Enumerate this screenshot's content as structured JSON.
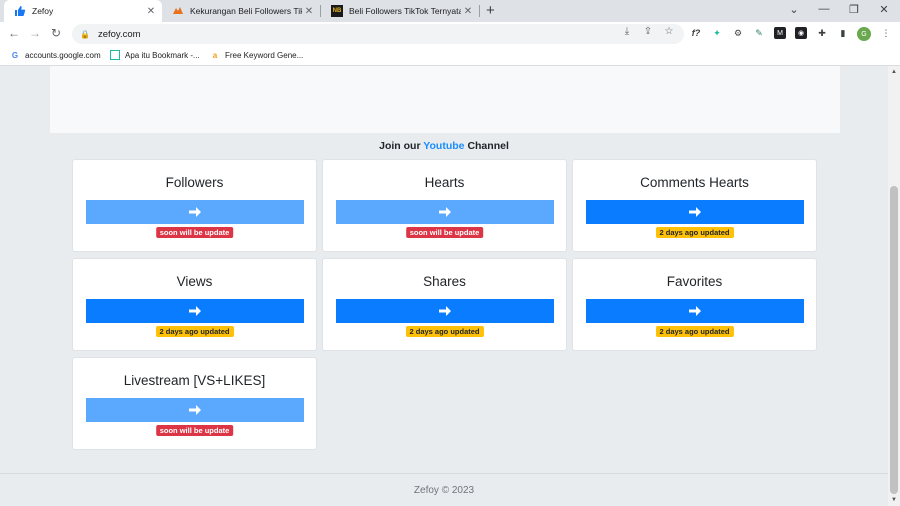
{
  "browser": {
    "tabs": [
      {
        "title": "Zefoy",
        "favicon": "thumbs-up-icon",
        "active": true
      },
      {
        "title": "Kekurangan Beli Followers TikTok...",
        "favicon": "site-icon",
        "active": false
      },
      {
        "title": "Beli Followers TikTok Ternyata Bi...",
        "favicon": "nb-logo-icon",
        "active": false
      }
    ],
    "tab_close": "✕",
    "new_tab": "+",
    "url": "zefoy.com",
    "profile_initial": "G",
    "bookmarks": [
      {
        "label": "accounts.google.com",
        "icon": "google-icon"
      },
      {
        "label": "Apa itu Bookmark -...",
        "icon": "page-icon"
      },
      {
        "label": "Free Keyword Gene...",
        "icon": "a-logo-icon"
      }
    ]
  },
  "page": {
    "join_prefix": "Join our",
    "join_link": "Youtube",
    "join_suffix": "Channel",
    "cards": [
      {
        "title": "Followers",
        "status": "soon will be update",
        "status_type": "red"
      },
      {
        "title": "Hearts",
        "status": "soon will be update",
        "status_type": "red"
      },
      {
        "title": "Comments Hearts",
        "status": "2 days ago updated",
        "status_type": "yellow"
      },
      {
        "title": "Views",
        "status": "2 days ago updated",
        "status_type": "yellow"
      },
      {
        "title": "Shares",
        "status": "2 days ago updated",
        "status_type": "yellow"
      },
      {
        "title": "Favorites",
        "status": "2 days ago updated",
        "status_type": "yellow"
      },
      {
        "title": "Livestream [VS+LIKES]",
        "status": "soon will be update",
        "status_type": "red"
      }
    ],
    "footer": "Zefoy © 2023"
  },
  "colors": {
    "button_light": "#5ba8ff",
    "button_strong": "#0a7cff",
    "badge_red": "#dc3545",
    "badge_yellow": "#ffc107",
    "link_blue": "#1a8cff"
  }
}
